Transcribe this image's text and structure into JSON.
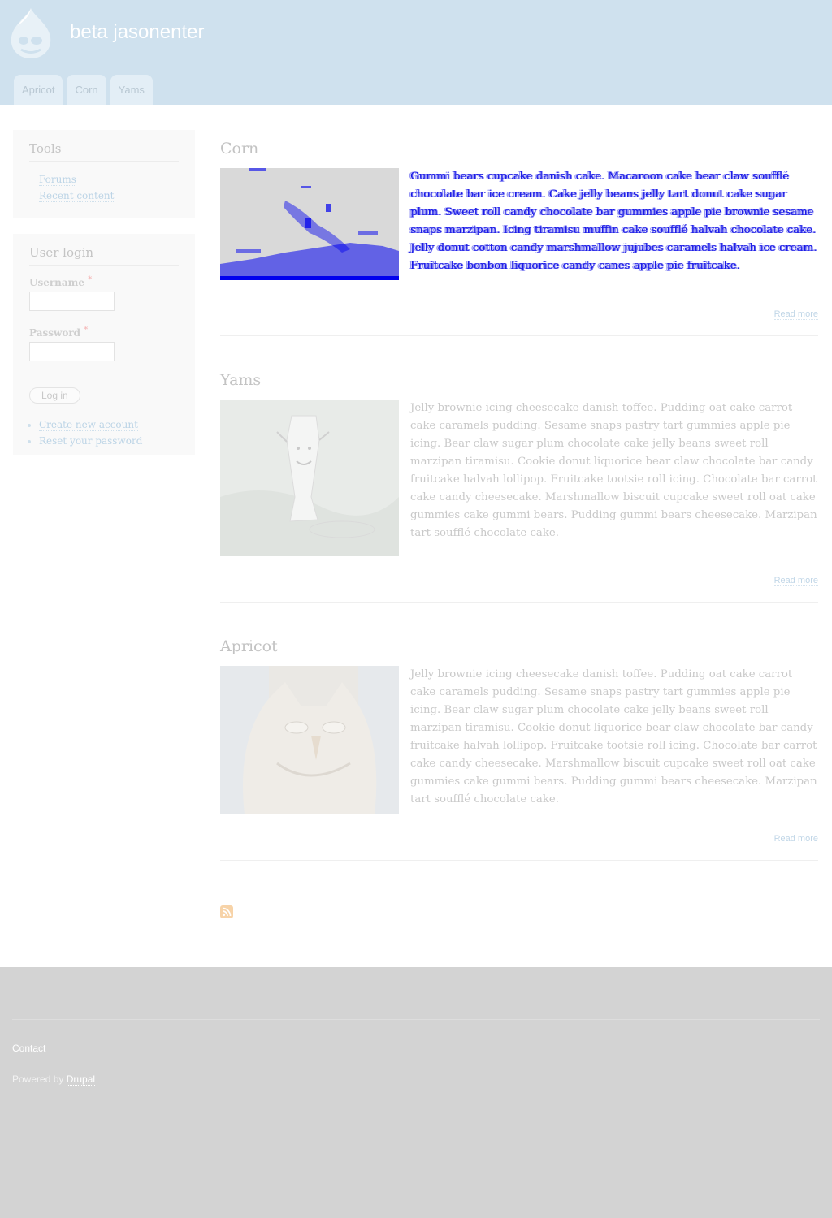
{
  "header": {
    "site_name": "beta jasonenter",
    "logo_icon": "drupal-drop-icon",
    "tabs": [
      {
        "label": "Apricot"
      },
      {
        "label": "Corn"
      },
      {
        "label": "Yams"
      }
    ]
  },
  "sidebar": {
    "tools": {
      "title": "Tools",
      "links": [
        {
          "label": "Forums"
        },
        {
          "label": "Recent content"
        }
      ]
    },
    "login": {
      "title": "User login",
      "username_label": "Username",
      "password_label": "Password",
      "required_marker": "*",
      "submit_label": "Log in",
      "links": [
        {
          "label": "Create new account"
        },
        {
          "label": "Reset your password"
        }
      ]
    }
  },
  "nodes": [
    {
      "title": "Corn",
      "teaser": "Gummi bears cupcake danish cake. Macaroon cake bear claw soufflé chocolate bar ice cream. Cake jelly beans jelly tart donut cake sugar plum. Sweet roll candy chocolate bar gummies apple pie brownie sesame snaps marzipan. Icing tiramisu muffin cake soufflé halvah chocolate cake. Jelly donut cotton candy marshmallow jujubes caramels halvah ice cream. Fruitcake bonbon liquorice candy canes apple pie fruitcake.",
      "read_more": "Read more",
      "image": "distorted-blue-noise-image"
    },
    {
      "title": "Yams",
      "teaser": "Jelly brownie icing cheesecake danish toffee. Pudding oat cake carrot cake caramels pudding. Sesame snaps pastry tart gummies apple pie icing. Bear claw sugar plum chocolate cake jelly beans sweet roll marzipan tiramisu. Cookie donut liquorice bear claw chocolate bar candy fruitcake halvah lollipop. Fruitcake tootsie roll icing. Chocolate bar carrot cake candy cheesecake. Marshmallow biscuit cupcake sweet roll oat cake gummies cake gummi bears. Pudding gummi bears cheesecake. Marzipan tart soufflé chocolate cake.",
      "read_more": "Read more",
      "image": "smiling-cup-image"
    },
    {
      "title": "Apricot",
      "teaser": "Jelly brownie icing cheesecake danish toffee. Pudding oat cake carrot cake caramels pudding. Sesame snaps pastry tart gummies apple pie icing. Bear claw sugar plum chocolate cake jelly beans sweet roll marzipan tiramisu. Cookie donut liquorice bear claw chocolate bar candy fruitcake halvah lollipop. Fruitcake tootsie roll icing. Chocolate bar carrot cake candy cheesecake. Marshmallow biscuit cupcake sweet roll oat cake gummies cake gummi bears. Pudding gummi bears cheesecake. Marzipan tart soufflé chocolate cake.",
      "read_more": "Read more",
      "image": "owl-image"
    }
  ],
  "feed_icon": "rss-feed-icon",
  "footer": {
    "contact": "Contact",
    "powered_prefix": "Powered by ",
    "powered_link": "Drupal"
  },
  "colors": {
    "header_bg": "#cfe1ee",
    "footer_bg": "#d3d3d3",
    "link": "#bcd4e6",
    "glitch_blue": "#0000ee"
  }
}
